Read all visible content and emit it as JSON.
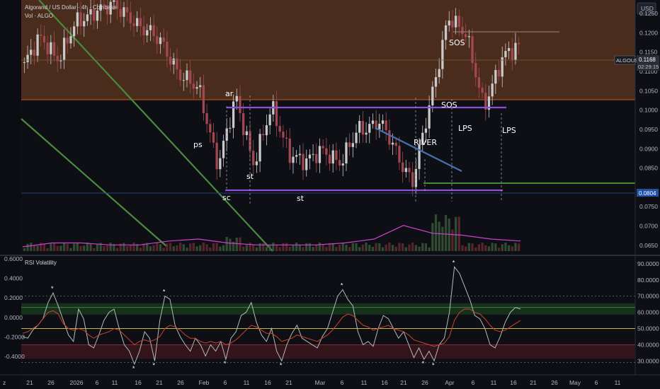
{
  "header": {
    "symbol_title": "Algorand / US Dollar · 4h · Coinbase",
    "volume_label": "Vol · ALGO",
    "currency": "USD"
  },
  "price_tag": {
    "symbol": "ALGOUSD",
    "price": "0.1168",
    "countdown": "02:29:15"
  },
  "level_tag": {
    "price": "0.0804"
  },
  "colors": {
    "background": "#0d0f14",
    "upper_zone": "#4a2c1c",
    "bull": "#c9c9c9",
    "bear": "#a34850",
    "wyckoff_line": "#8c4fd6",
    "river_line": "#4a6fb0",
    "trend_line": "#4a8a3e",
    "support_line": "#4a9e3e",
    "volume_ma": "#d040d0",
    "rsi_line": "#b0bcb8",
    "rsi_signal": "#d04030",
    "rsi_mid": "#c8b838"
  },
  "price_axis": [
    "0.1250",
    "0.1200",
    "0.1150",
    "0.1100",
    "0.1050",
    "0.1000",
    "0.0950",
    "0.0900",
    "0.0850",
    "0.0750",
    "0.0700",
    "0.0650"
  ],
  "time_axis": [
    "21",
    "26",
    "2026",
    "6",
    "11",
    "16",
    "21",
    "26",
    "Feb",
    "6",
    "11",
    "16",
    "21",
    "Mar",
    "6",
    "11",
    "16",
    "21",
    "26",
    "Apr",
    "6",
    "11",
    "16",
    "21",
    "26",
    "May",
    "6",
    "11"
  ],
  "annotations": [
    "ps",
    "ar",
    "sc",
    "st",
    "st",
    "RIVER",
    "SOS",
    "SOS",
    "LPS",
    "LPS"
  ],
  "rsi_panel": {
    "title": "RSI Volatility",
    "left_axis": [
      "0.6000",
      "0.4000",
      "0.2000",
      "0.0000",
      "-0.2000",
      "-0.4000"
    ],
    "right_axis": [
      "90.0000",
      "80.0000",
      "70.0000",
      "60.0000",
      "50.0000",
      "40.0000",
      "30.0000"
    ]
  },
  "chart_data": {
    "type": "candlestick",
    "title": "Algorand / US Dollar · 4h · Coinbase",
    "y_range": [
      0.0635,
      0.1285
    ],
    "x_range": [
      "Dec 18",
      "May 15"
    ],
    "last_price": 0.1168,
    "key_levels": {
      "range_top": 0.1038,
      "range_bottom": 0.0814,
      "support": 0.083,
      "resistance": 0.124,
      "zone_boundary": 0.1058,
      "marked": 0.0804
    },
    "ohlc_sketch": [
      {
        "date": "Dec 18",
        "close": 0.1115
      },
      {
        "date": "Dec 24",
        "close": 0.1185
      },
      {
        "date": "Dec 30",
        "close": 0.114
      },
      {
        "date": "Jan 3",
        "close": 0.122
      },
      {
        "date": "Jan 8",
        "close": 0.1268
      },
      {
        "date": "Jan 13",
        "close": 0.126
      },
      {
        "date": "Jan 17",
        "close": 0.125
      },
      {
        "date": "Jan 21",
        "close": 0.1195
      },
      {
        "date": "Jan 25",
        "close": 0.1165
      },
      {
        "date": "Jan 29",
        "close": 0.108
      },
      {
        "date": "Feb 2",
        "close": 0.104
      },
      {
        "date": "Feb 5",
        "close": 0.086
      },
      {
        "date": "Feb 7",
        "close": 0.1025
      },
      {
        "date": "Feb 13",
        "close": 0.087
      },
      {
        "date": "Feb 15",
        "close": 0.0995
      },
      {
        "date": "Feb 21",
        "close": 0.09
      },
      {
        "date": "Feb 27",
        "close": 0.0855
      },
      {
        "date": "Mar 4",
        "close": 0.0905
      },
      {
        "date": "Mar 10",
        "close": 0.086
      },
      {
        "date": "Mar 17",
        "close": 0.0955
      },
      {
        "date": "Mar 20",
        "close": 0.0975
      },
      {
        "date": "Mar 25",
        "close": 0.089
      },
      {
        "date": "Mar 29",
        "close": 0.0825
      },
      {
        "date": "Apr 1",
        "close": 0.101
      },
      {
        "date": "Apr 4",
        "close": 0.1255
      },
      {
        "date": "Apr 8",
        "close": 0.1185
      },
      {
        "date": "Apr 13",
        "close": 0.102
      },
      {
        "date": "Apr 16",
        "close": 0.112
      },
      {
        "date": "Apr 18",
        "close": 0.1168
      }
    ],
    "volume_ma_sketch": [
      0.0,
      0.1,
      0.1,
      0.05,
      0.05,
      0.15,
      0.2,
      0.1,
      0.05,
      0.05,
      0.05,
      0.1,
      0.2,
      0.55,
      0.35,
      0.3,
      0.2,
      0.15
    ]
  },
  "rsi_data": {
    "y_range": [
      24,
      93
    ],
    "levels": {
      "overbought": 70,
      "upper_band": 63,
      "mid": 50,
      "lower_band": 40,
      "oversold": 29
    },
    "rsi_sketch": [
      45,
      44,
      49,
      52,
      56,
      66,
      72,
      64,
      55,
      46,
      42,
      62,
      56,
      40,
      38,
      46,
      55,
      60,
      62,
      50,
      40,
      36,
      28,
      36,
      48,
      44,
      30,
      55,
      70,
      68,
      52,
      45,
      40,
      36,
      44,
      40,
      33,
      40,
      36,
      42,
      31,
      44,
      48,
      58,
      60,
      66,
      54,
      46,
      42,
      50,
      36,
      30,
      40,
      47,
      52,
      44,
      42,
      40,
      38,
      45,
      50,
      60,
      70,
      74,
      68,
      64,
      48,
      40,
      42,
      39,
      50,
      58,
      56,
      50,
      44,
      48,
      40,
      32,
      38,
      31,
      36,
      30,
      40,
      44,
      60,
      88,
      84,
      76,
      68,
      58,
      56,
      50,
      40,
      38,
      45,
      54,
      60,
      63,
      62
    ],
    "signal_sketch": [
      47,
      48,
      50,
      52,
      56,
      60,
      61,
      59,
      53,
      50,
      49,
      50,
      49,
      46,
      44,
      46,
      47,
      48,
      50,
      49,
      46,
      43,
      40,
      42,
      43,
      42,
      43,
      45,
      50,
      52,
      51,
      49,
      46,
      44,
      44,
      42,
      41,
      42,
      41,
      42,
      40,
      41,
      43,
      46,
      49,
      52,
      51,
      49,
      47,
      47,
      45,
      42,
      43,
      44,
      46,
      45,
      44,
      43,
      42,
      44,
      46,
      49,
      53,
      57,
      59,
      58,
      55,
      52,
      51,
      49,
      50,
      51,
      52,
      50,
      49,
      48,
      46,
      43,
      42,
      41,
      40,
      39,
      40,
      41,
      45,
      55,
      60,
      62,
      62,
      60,
      59,
      56,
      52,
      49,
      48,
      49,
      51,
      53,
      55
    ]
  }
}
